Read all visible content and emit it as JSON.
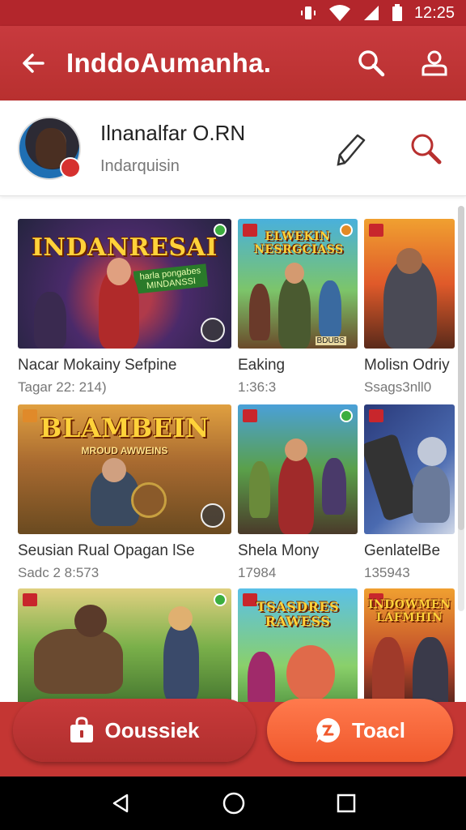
{
  "status_bar": {
    "time": "12:25",
    "icons": [
      "vibrate-icon",
      "wifi-icon",
      "signal-icon",
      "battery-icon"
    ]
  },
  "app_bar": {
    "title": "InddoAumanha.",
    "icons": [
      "back-arrow-icon",
      "search-icon",
      "profile-icon"
    ]
  },
  "profile": {
    "name": "Ilnanalfar O.RN",
    "subtitle": "Indarquisin",
    "icons": [
      "pen-icon",
      "search-icon"
    ]
  },
  "cards": [
    {
      "art_title": "INDANRESAI",
      "art_sub": "harla pongabes MINDANSSI",
      "title": "Nacar Mokainy Sefpine",
      "meta": "Tagar 22: 214)"
    },
    {
      "art_title": "ELWEKIN NESRGCIASS",
      "art_sub": "BDUBS",
      "title": "Eaking",
      "meta": "1:36:3"
    },
    {
      "art_title": "",
      "art_sub": "",
      "title": "Molisn Odriy",
      "meta": "Ssags3nll0"
    },
    {
      "art_title": "BLAMBEIN",
      "art_sub": "MROUD AWWEINS",
      "title": "Seusian Rual Opagan lSe",
      "meta": "Sadc 2 8:573"
    },
    {
      "art_title": "",
      "art_sub": "",
      "title": "Shela  Mony",
      "meta": "17984"
    },
    {
      "art_title": "",
      "art_sub": "",
      "title": "GenlatelBe",
      "meta": "135943"
    },
    {
      "art_title": "",
      "art_sub": "",
      "title": "",
      "meta": ""
    },
    {
      "art_title": "TSASDRES RAWESS",
      "art_sub": "",
      "title": "",
      "meta": ""
    },
    {
      "art_title": "INDOWMEN LAFMHIN",
      "art_sub": "",
      "title": "",
      "meta": ""
    }
  ],
  "buttons": {
    "left_label": "Ooussiek",
    "right_label": "Toacl"
  },
  "colors": {
    "primary": "#b8302f",
    "accent": "#f0582c"
  }
}
